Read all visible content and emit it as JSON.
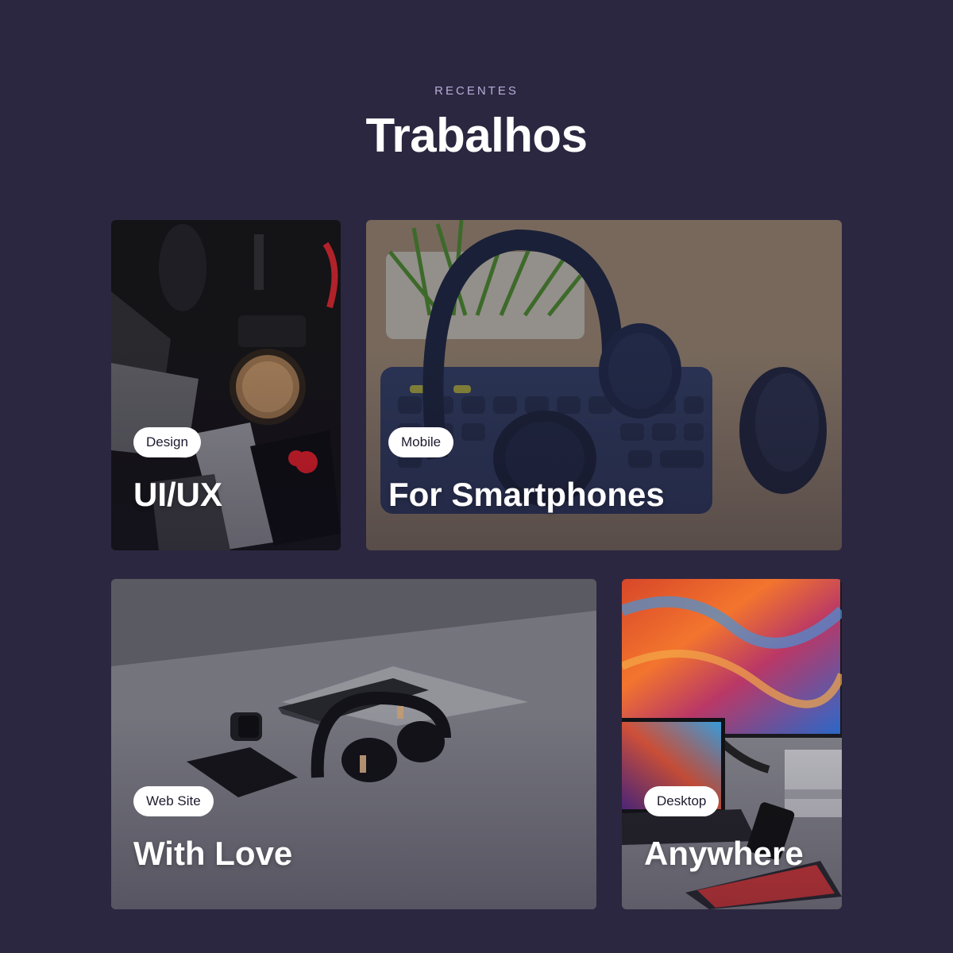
{
  "section": {
    "eyebrow": "RECENTES",
    "title": "Trabalhos"
  },
  "cards": [
    {
      "tag": "Design",
      "title": "UI/UX"
    },
    {
      "tag": "Mobile",
      "title": "For Smartphones"
    },
    {
      "tag": "Web Site",
      "title": "With Love"
    },
    {
      "tag": "Desktop",
      "title": "Anywhere"
    }
  ],
  "colors": {
    "background": "#2c2740",
    "eyebrow": "#b7aed8",
    "title": "#ffffff",
    "tag_background": "#ffffff",
    "tag_text": "#1e1a2e"
  }
}
